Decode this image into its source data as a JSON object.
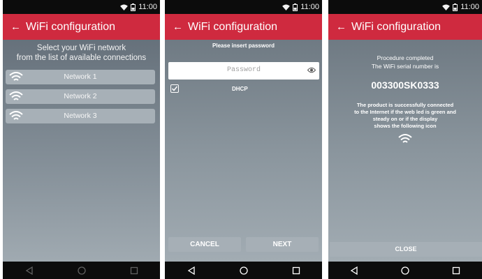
{
  "status_bar": {
    "time": "11:00",
    "icons": [
      "wifi-icon",
      "battery-icon"
    ]
  },
  "screen1": {
    "title": "WiFi configuration",
    "back_icon": "←",
    "intro_line1": "Select your WiFi network",
    "intro_line2": "from the list of available connections",
    "networks": [
      {
        "label": "Network 1",
        "icon": "wifi-icon"
      },
      {
        "label": "Network 2",
        "icon": "wifi-icon"
      },
      {
        "label": "Network 3",
        "icon": "wifi-icon"
      }
    ]
  },
  "screen2": {
    "title": "WiFi configuration",
    "back_icon": "←",
    "instruction": "Please insert password",
    "password_placeholder": "Password",
    "password_value": "",
    "dhcp_label": "DHCP",
    "dhcp_checked": true,
    "cancel_label": "CANCEL",
    "next_label": "NEXT"
  },
  "screen3": {
    "title": "WiFi configuration",
    "back_icon": "←",
    "line1": "Procedure completed",
    "line2": "The WiFi serial number is",
    "serial": "003300SK0333",
    "msg1": "The product is successfully connected",
    "msg2": "to the Internet if the web led is green and",
    "msg3": "steady on or if the display",
    "msg4": "shows the following icon",
    "close_label": "CLOSE"
  },
  "colors": {
    "accent": "#cf2a3f",
    "background_top": "#6f7a83",
    "button": "#a6afb6"
  }
}
